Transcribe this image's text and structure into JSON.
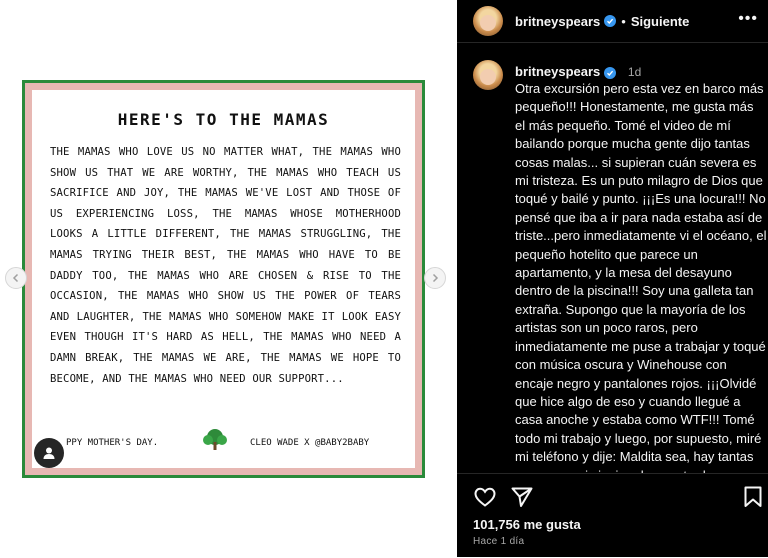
{
  "post": {
    "poster": {
      "title": "HERE'S TO THE MAMAS",
      "body": "The mamas who love us no matter what, the mamas who show us that we are worthy, the mamas who teach us sacrifice and joy, the mamas we've lost and those of us experiencing loss, the mamas whose motherhood looks a little different, the mamas struggling, the mamas trying their best, the mamas who have to be daddy too, the mamas who are chosen & rise to the occasion, the mamas who show us the power of tears and laughter, the mamas who somehow make it look easy even though it's hard as hell, the mamas who need a damn break, the mamas we are, the mamas we hope to become, and the mamas who need our support...",
      "footer_left": "ppy mother's day.",
      "footer_logo": "BABY2BABY",
      "footer_right": "Cleo Wade x @baby2baby"
    },
    "nav": {
      "prev_icon": "chevron-left-icon",
      "next_icon": "chevron-right-icon"
    },
    "tag_icon": "user-tag-icon"
  },
  "header": {
    "username": "britneyspears",
    "separator": "•",
    "follow_label": "Siguiente",
    "more_icon": "•••"
  },
  "caption": {
    "username": "britneyspears",
    "time": "1d",
    "text": "Otra excursión pero esta vez en barco más pequeño!!! Honestamente, me gusta más el más pequeño. Tomé el video de mí bailando porque mucha gente dijo tantas cosas malas... si supieran cuán severa es mi tristeza. Es un puto milagro de Dios que toqué y bailé y punto. ¡¡¡Es una locura!!! No pensé que iba a ir para nada estaba así de triste...pero inmediatamente vi el océano, el pequeño hotelito que parece un apartamento, y la mesa del desayuno dentro de la piscina!!! Soy una galleta tan extraña. Supongo que la mayoría de los artistas son un poco raros, pero inmediatamente me puse a trabajar y toqué con música oscura y Winehouse con encaje negro y pantalones rojos. ¡¡¡Olvidé que hice algo de eso y cuando llegué a casa anoche y estaba como WTF!!! Tomé todo mi trabajo y luego, por supuesto, miré mi teléfono y dije: Maldita sea, hay tantas cosas que ni siquiera he mostrado, pero me entristece que la gente"
  },
  "actions": {
    "like_icon": "heart-icon",
    "share_icon": "send-icon",
    "save_icon": "bookmark-icon",
    "likes": "101,756 me gusta",
    "ago": "Hace 1 día"
  },
  "colors": {
    "frame_green": "#2a8a3a",
    "frame_pink": "#e7b8b3",
    "verified_blue": "#3797f0",
    "panel_bg": "#000000"
  }
}
